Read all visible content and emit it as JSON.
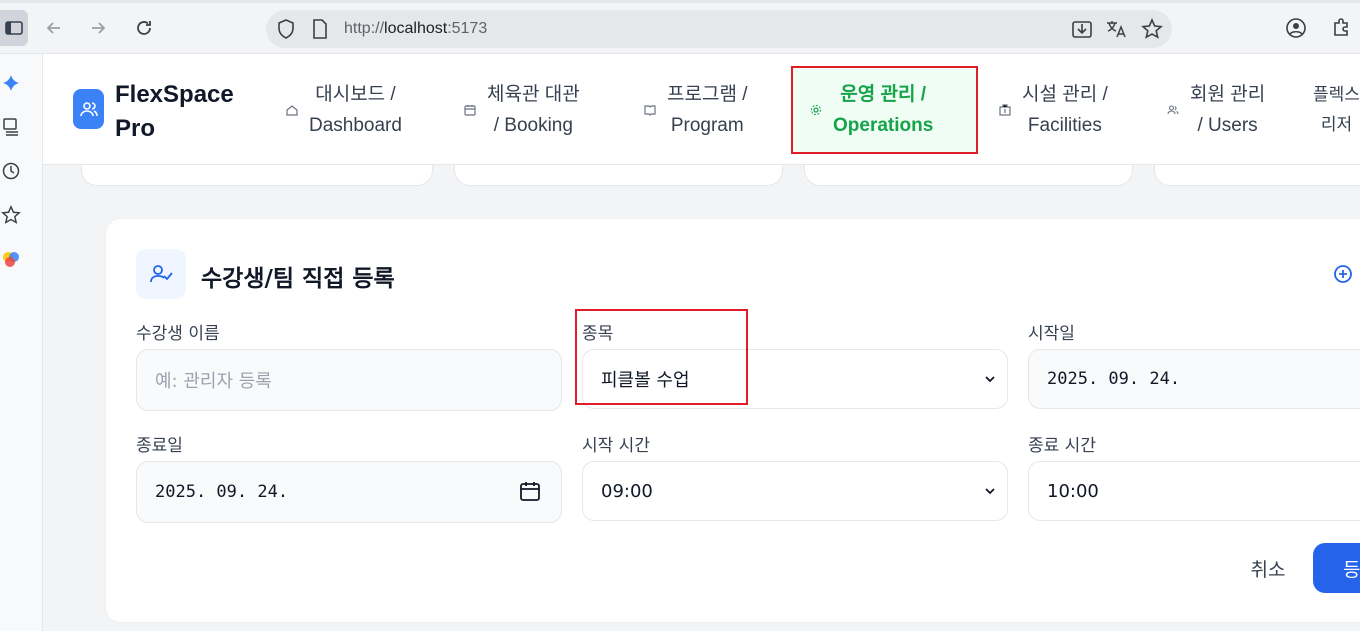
{
  "browser": {
    "url_protocol": "http://",
    "url_host": "localhost",
    "url_port": ":5173"
  },
  "app": {
    "brand_line1": "FlexSpace",
    "brand_line2": "Pro",
    "nav": [
      {
        "line1": "대시보드 /",
        "line2": "Dashboard",
        "icon": "home-icon"
      },
      {
        "line1": "체육관 대관",
        "line2": "/ Booking",
        "icon": "calendar-icon"
      },
      {
        "line1": "프로그램 /",
        "line2": "Program",
        "icon": "book-icon"
      },
      {
        "line1": "운영 관리 /",
        "line2": "Operations",
        "icon": "gear-icon",
        "active": true
      },
      {
        "line1": "시설 관리 /",
        "line2": "Facilities",
        "icon": "building-icon"
      },
      {
        "line1": "회원 관리",
        "line2": "/ Users",
        "icon": "users-icon"
      },
      {
        "line1": "플렉스",
        "line2": "리저",
        "icon": ""
      }
    ],
    "accent_color": "#16a34a",
    "primary_color": "#2563eb"
  },
  "form": {
    "title": "수강생/팀 직접 등록",
    "student_name_label": "수강생 이름",
    "student_name_placeholder": "예: 관리자 등록",
    "sport_label": "종목",
    "sport_value": "피클볼 수업",
    "start_date_label": "시작일",
    "start_date_value": "2025. 09. 24.",
    "end_date_label": "종료일",
    "end_date_value": "2025. 09. 24.",
    "start_time_label": "시작 시간",
    "start_time_value": "09:00",
    "end_time_label": "종료 시간",
    "end_time_value": "10:00",
    "cancel_label": "취소",
    "submit_label": "등"
  }
}
